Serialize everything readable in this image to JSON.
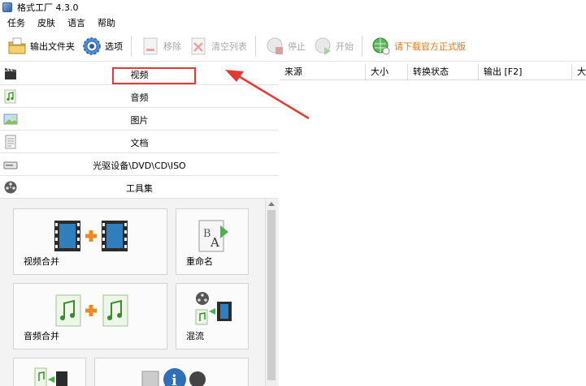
{
  "window": {
    "title": "格式工厂 4.3.0"
  },
  "menu": {
    "items": [
      "任务",
      "皮肤",
      "语言",
      "帮助"
    ]
  },
  "toolbar": {
    "output_folder": "输出文件夹",
    "options": "选项",
    "remove": "移除",
    "clear_list": "清空列表",
    "stop": "停止",
    "start": "开始",
    "download_official": "请下载官方正式版"
  },
  "categories": {
    "video": "视频",
    "audio": "音频",
    "image": "图片",
    "document": "文档",
    "optical": "光驱设备\\DVD\\CD\\ISO",
    "tools": "工具集"
  },
  "tools": {
    "video_merge": "视频合并",
    "rename": "重命名",
    "audio_merge": "音频合并",
    "mux": "混流"
  },
  "task_table": {
    "columns": [
      "来源",
      "大小",
      "转换状态",
      "输出 [F2]",
      "大"
    ]
  },
  "colors": {
    "highlight_box": "#e53935",
    "promo_text": "#e07a1a",
    "disabled_text": "#a8a8a8"
  }
}
